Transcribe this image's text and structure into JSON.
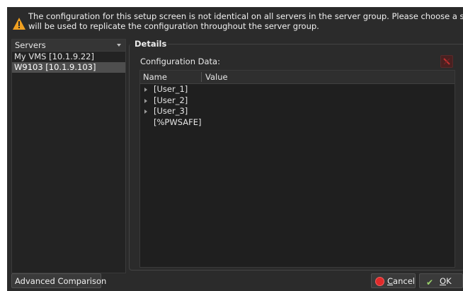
{
  "banner": {
    "line1": "The configuration for this setup screen is not identical on all servers in the server group. Please choose a server that",
    "line2": "will be used to replicate the configuration throughout the server group."
  },
  "servers": {
    "header": "Servers",
    "items": [
      {
        "label": "My VMS  [10.1.9.22]",
        "selected": false
      },
      {
        "label": "W9103 [10.1.9.103]",
        "selected": true
      }
    ]
  },
  "details": {
    "group_label": "Details",
    "config_label": "Configuration Data:",
    "columns": {
      "name": "Name",
      "value": "Value"
    },
    "rows": [
      {
        "label": "[User_1]",
        "expandable": true
      },
      {
        "label": "[User_2]",
        "expandable": true
      },
      {
        "label": "[User_3]",
        "expandable": true
      },
      {
        "label": "[%PWSAFE]",
        "expandable": false
      }
    ]
  },
  "buttons": {
    "advanced": "Advanced Comparison",
    "cancel_mnemonic": "C",
    "cancel_rest": "ancel",
    "ok_mnemonic": "O",
    "ok_rest": "K"
  },
  "colors": {
    "background": "#2b2b2b",
    "selection": "#4e4e4e",
    "warning": "#f0a020",
    "cancel": "#e02a2a",
    "ok": "#9bd36b"
  }
}
